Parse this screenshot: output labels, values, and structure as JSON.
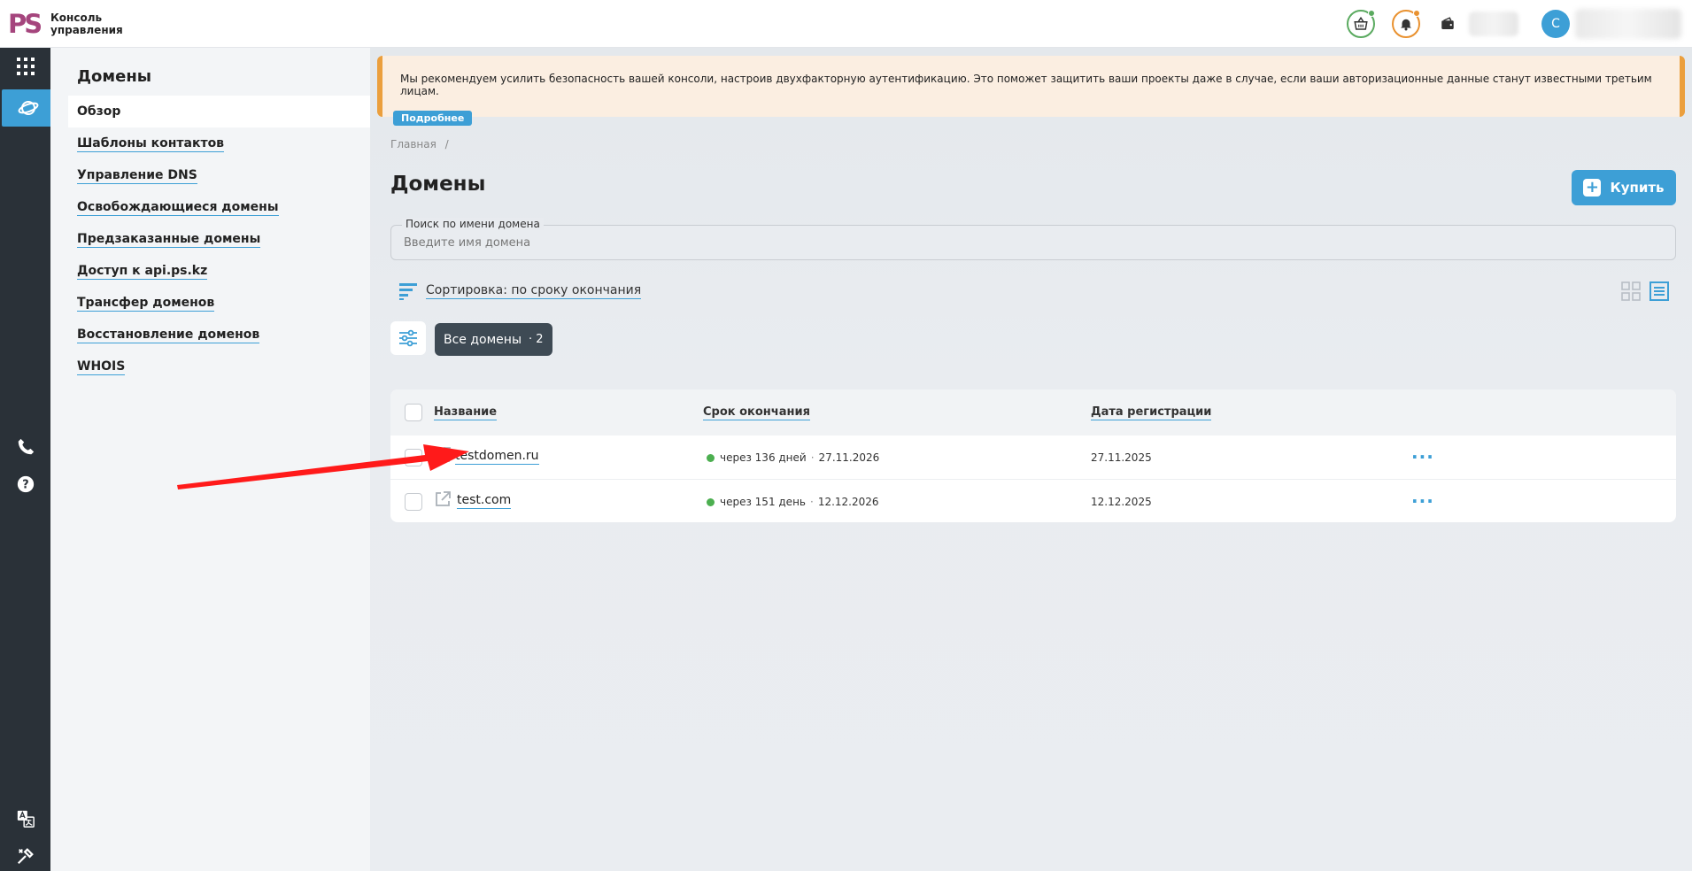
{
  "header": {
    "logo_mark": "PS",
    "logo_text": "Консоль управления",
    "avatar_letter": "С"
  },
  "sidebar": {
    "title": "Домены",
    "items": [
      {
        "label": "Обзор"
      },
      {
        "label": "Шаблоны контактов"
      },
      {
        "label": "Управление DNS"
      },
      {
        "label": "Освобождающиеся домены"
      },
      {
        "label": "Предзаказанные домены"
      },
      {
        "label": "Доступ к api.ps.kz"
      },
      {
        "label": "Трансфер доменов"
      },
      {
        "label": "Восстановление доменов"
      },
      {
        "label": "WHOIS"
      }
    ]
  },
  "alert": {
    "text": "Мы рекомендуем усилить безопасность вашей консоли, настроив двухфакторную аутентификацию. Это поможет защитить ваши проекты даже в случае, если ваши авторизационные данные станут известными третьим лицам.",
    "more": "Подробнее"
  },
  "breadcrumb": {
    "home": "Главная",
    "sep": "/"
  },
  "page": {
    "title": "Домены",
    "buy_label": "Купить"
  },
  "search": {
    "label": "Поиск по имени домена",
    "placeholder": "Введите имя домена",
    "value": ""
  },
  "sort": {
    "label": "Сортировка: по сроку окончания"
  },
  "filter_chip": {
    "label": "Все домены",
    "count": "· 2"
  },
  "table": {
    "columns": {
      "name": "Название",
      "expiry": "Срок окончания",
      "registered": "Дата регистрации"
    },
    "rows": [
      {
        "name": "testdomen.ru",
        "expires_in": "через 136 дней",
        "expiry_date": "27.11.2026",
        "registered": "27.11.2025"
      },
      {
        "name": "test.com",
        "expires_in": "через 151 день",
        "expiry_date": "12.12.2026",
        "registered": "12.12.2025"
      }
    ],
    "dot_sep": "·",
    "more": "···"
  },
  "colors": {
    "accent": "#3d9fd6",
    "brand": "#a5457d",
    "warning": "#eb9f3d",
    "ok": "#4caf50",
    "annotation_arrow": "#ff1a1a"
  },
  "icons": {
    "rail": [
      "apps-grid-icon",
      "domains-globe-icon",
      "phone-icon",
      "help-icon",
      "translate-icon",
      "tools-icon"
    ],
    "header": [
      "basket-icon",
      "bell-icon",
      "wallet-icon"
    ]
  }
}
